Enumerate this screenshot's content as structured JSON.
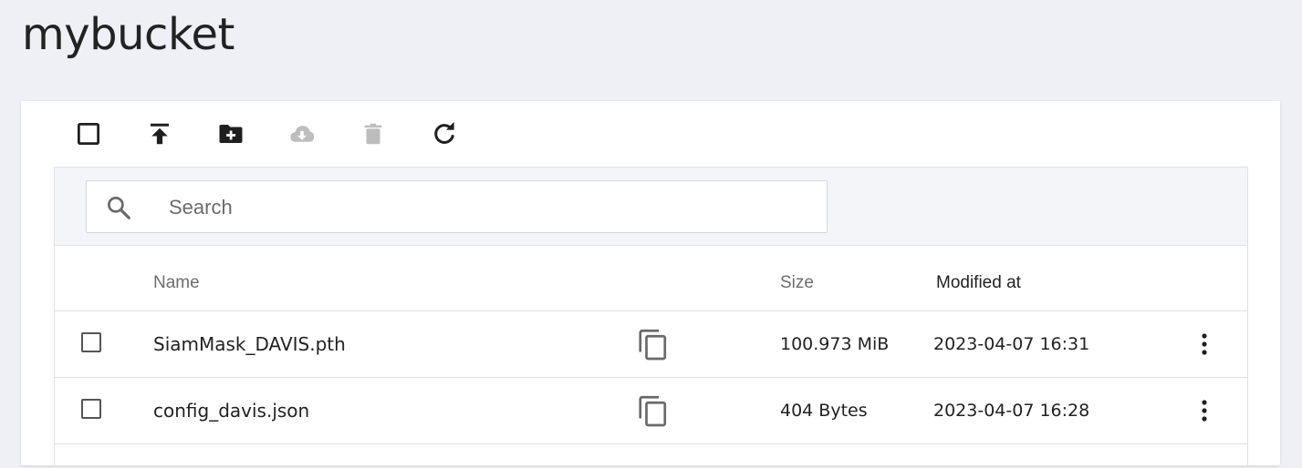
{
  "bucket": {
    "title": "mybucket"
  },
  "toolbar": {
    "items": [
      {
        "icon": "checkbox-blank-icon",
        "enabled": true
      },
      {
        "icon": "upload-icon",
        "enabled": true
      },
      {
        "icon": "new-folder-icon",
        "enabled": true
      },
      {
        "icon": "cloud-download-icon",
        "enabled": false
      },
      {
        "icon": "delete-icon",
        "enabled": false
      },
      {
        "icon": "refresh-icon",
        "enabled": true
      }
    ],
    "enabled_color": "#1f1f1f",
    "disabled_color": "#bdbdbd"
  },
  "search": {
    "placeholder": "Search",
    "value": ""
  },
  "table": {
    "headers": {
      "name": "Name",
      "size": "Size",
      "modified": "Modified at"
    },
    "rows": [
      {
        "name": "SiamMask_DAVIS.pth",
        "size": "100.973 MiB",
        "modified": "2023-04-07 16:31"
      },
      {
        "name": "config_davis.json",
        "size": "404 Bytes",
        "modified": "2023-04-07 16:28"
      }
    ]
  }
}
